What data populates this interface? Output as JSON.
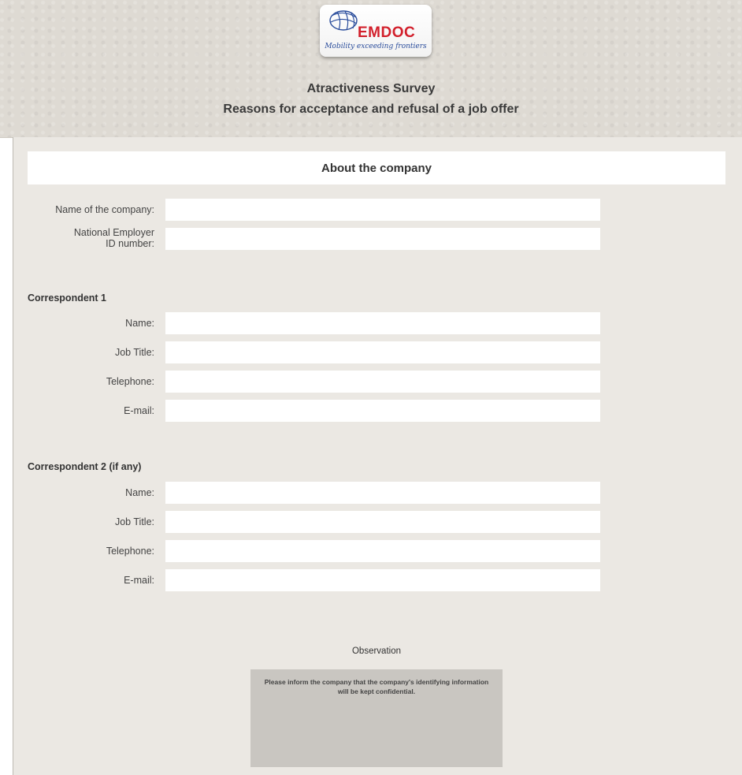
{
  "header": {
    "logo": {
      "brand": "EMDOC",
      "tagline": "Mobility exceeding frontiers",
      "icon": "globe-icon"
    },
    "title": "Atractiveness Survey",
    "subtitle": "Reasons for acceptance and refusal of a job offer"
  },
  "section": {
    "title": "About the company"
  },
  "company": {
    "name_label": "Name of the company:",
    "name_value": "",
    "id_label_line1": "National Employer",
    "id_label_line2": "ID number:",
    "id_value": ""
  },
  "correspondent1": {
    "title": "Correspondent 1",
    "name_label": "Name:",
    "name_value": "",
    "job_label": "Job Title:",
    "job_value": "",
    "phone_label": "Telephone:",
    "phone_value": "",
    "email_label": "E-mail:",
    "email_value": ""
  },
  "correspondent2": {
    "title": "Correspondent 2 (if any)",
    "name_label": "Name:",
    "name_value": "",
    "job_label": "Job Title:",
    "job_value": "",
    "phone_label": "Telephone:",
    "phone_value": "",
    "email_label": "E-mail:",
    "email_value": ""
  },
  "observation": {
    "title": "Observation",
    "text": "Please inform the company that the company's identifying information will be kept confidential."
  },
  "colors": {
    "brand_red": "#d21f2b",
    "brand_blue": "#2a4d9c",
    "panel_bg": "#ebe8e3",
    "header_bg": "#dedad3"
  }
}
